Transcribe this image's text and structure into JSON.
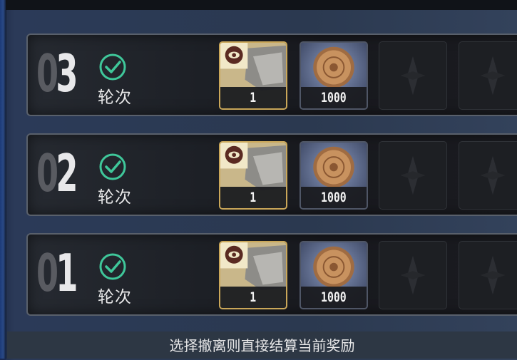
{
  "rounds": [
    {
      "zero_digit": "0",
      "main_digit": "3",
      "label": "轮次",
      "completed": true,
      "rewards": [
        {
          "icon": "gold-badge-item-icon",
          "count": "1"
        },
        {
          "icon": "bronze-coin-icon",
          "count": "1000"
        },
        {
          "icon": "empty-slot-icon",
          "count": null
        },
        {
          "icon": "empty-slot-icon",
          "count": null
        }
      ]
    },
    {
      "zero_digit": "0",
      "main_digit": "2",
      "label": "轮次",
      "completed": true,
      "rewards": [
        {
          "icon": "gold-badge-item-icon",
          "count": "1"
        },
        {
          "icon": "bronze-coin-icon",
          "count": "1000"
        },
        {
          "icon": "empty-slot-icon",
          "count": null
        },
        {
          "icon": "empty-slot-icon",
          "count": null
        }
      ]
    },
    {
      "zero_digit": "0",
      "main_digit": "1",
      "label": "轮次",
      "completed": true,
      "rewards": [
        {
          "icon": "gold-badge-item-icon",
          "count": "1"
        },
        {
          "icon": "bronze-coin-icon",
          "count": "1000"
        },
        {
          "icon": "empty-slot-icon",
          "count": null
        },
        {
          "icon": "empty-slot-icon",
          "count": null
        }
      ]
    }
  ],
  "footer": {
    "message": "选择撤离则直接结算当前奖励"
  },
  "colors": {
    "check_green": "#3fc79a",
    "rare_border": "#caa759",
    "coin_bronze": "#b9865a"
  }
}
